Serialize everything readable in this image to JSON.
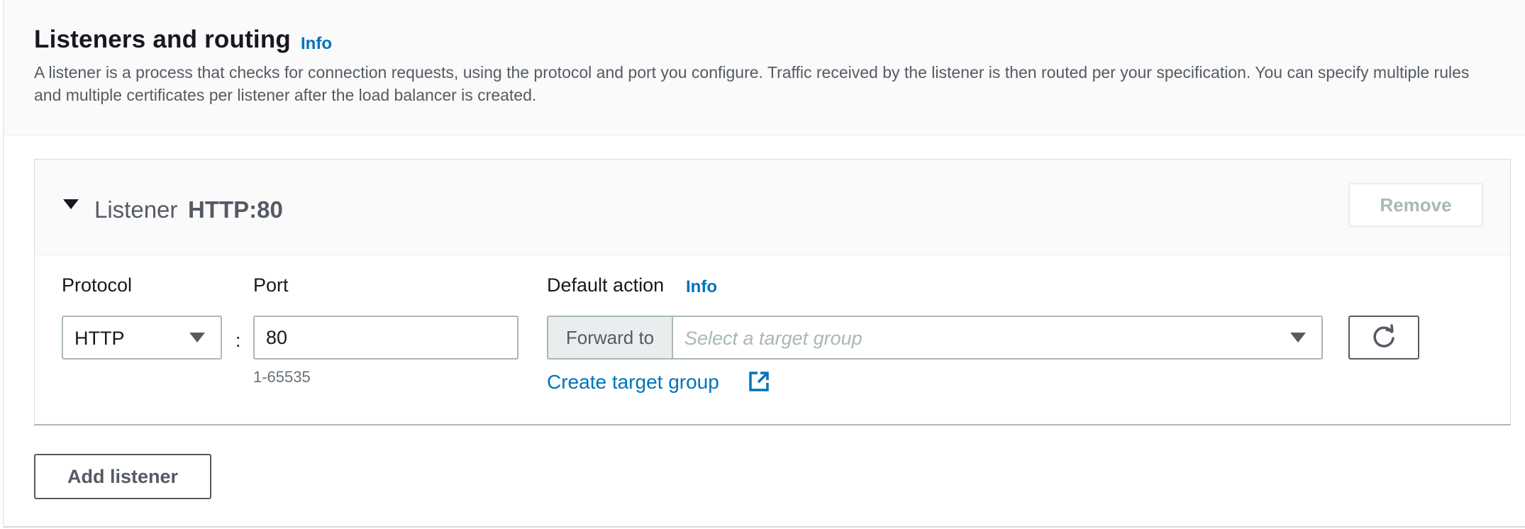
{
  "section": {
    "title": "Listeners and routing",
    "info_link": "Info",
    "description": "A listener is a process that checks for connection requests, using the protocol and port you configure. Traffic received by the listener is then routed per your specification. You can specify multiple rules and multiple certificates per listener after the load balancer is created."
  },
  "listener": {
    "label": "Listener",
    "name": "HTTP:80",
    "remove_label": "Remove",
    "protocol": {
      "label": "Protocol",
      "value": "HTTP"
    },
    "colon": ":",
    "port": {
      "label": "Port",
      "value": "80",
      "hint": "1-65535"
    },
    "default_action": {
      "label": "Default action",
      "info_link": "Info",
      "prefix": "Forward to",
      "placeholder": "Select a target group",
      "create_link": "Create target group"
    }
  },
  "add_listener_label": "Add listener",
  "icons": {
    "expand": "caret-down-icon",
    "select_caret": "caret-down-icon",
    "external": "external-link-icon",
    "refresh": "refresh-icon"
  },
  "colors": {
    "link": "#0073bb",
    "text": "#16191f",
    "muted": "#545b64",
    "border": "#aab7b8",
    "disabled": "#aab7b8"
  }
}
